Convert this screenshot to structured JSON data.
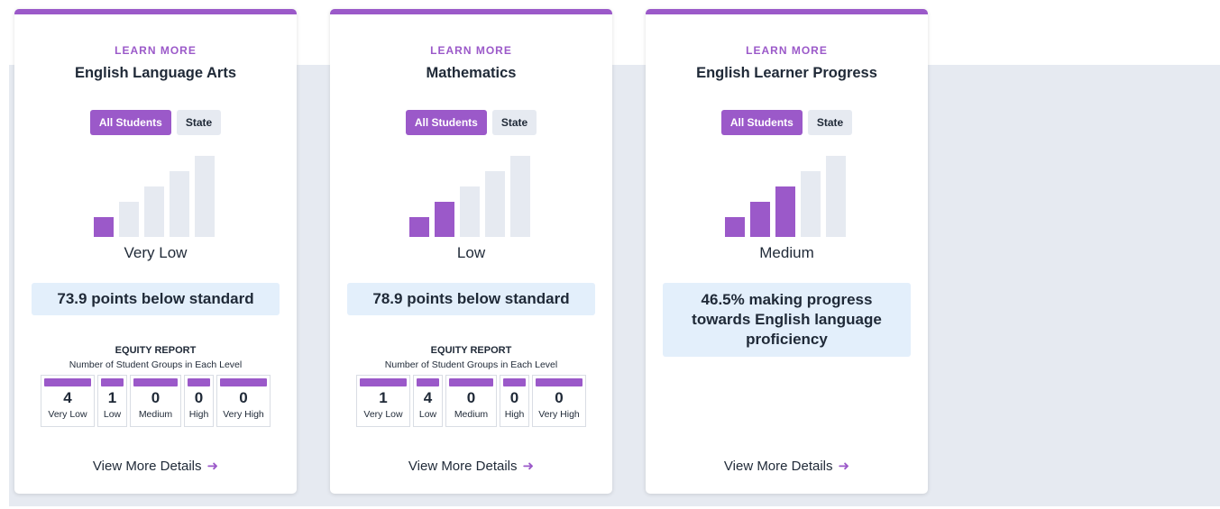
{
  "colors": {
    "accent": "#9b59c9",
    "band": "#e6eaf1",
    "status_bg": "#e3effb"
  },
  "cards": [
    {
      "learn_more": "LEARN MORE",
      "title": "English Language Arts",
      "toggle": [
        "All Students",
        "State"
      ],
      "level": "Very Low",
      "level_index": 1,
      "status": "73.9 points below standard",
      "equity": {
        "title": "EQUITY REPORT",
        "subtitle": "Number of Student Groups in Each Level",
        "cells": [
          {
            "count": "4",
            "label": "Very Low"
          },
          {
            "count": "1",
            "label": "Low"
          },
          {
            "count": "0",
            "label": "Medium"
          },
          {
            "count": "0",
            "label": "High"
          },
          {
            "count": "0",
            "label": "Very High"
          }
        ]
      },
      "details": "View More Details",
      "details_icon": "arrow-right-icon"
    },
    {
      "learn_more": "LEARN MORE",
      "title": "Mathematics",
      "toggle": [
        "All Students",
        "State"
      ],
      "level": "Low",
      "level_index": 2,
      "status": "78.9 points below standard",
      "equity": {
        "title": "EQUITY REPORT",
        "subtitle": "Number of Student Groups in Each Level",
        "cells": [
          {
            "count": "1",
            "label": "Very Low"
          },
          {
            "count": "4",
            "label": "Low"
          },
          {
            "count": "0",
            "label": "Medium"
          },
          {
            "count": "0",
            "label": "High"
          },
          {
            "count": "0",
            "label": "Very High"
          }
        ]
      },
      "details": "View More Details",
      "details_icon": "arrow-right-icon"
    },
    {
      "learn_more": "LEARN MORE",
      "title": "English Learner Progress",
      "toggle": [
        "All Students",
        "State"
      ],
      "level": "Medium",
      "level_index": 3,
      "status": "46.5% making progress towards English language proficiency",
      "details": "View More Details",
      "details_icon": "arrow-right-icon"
    }
  ]
}
